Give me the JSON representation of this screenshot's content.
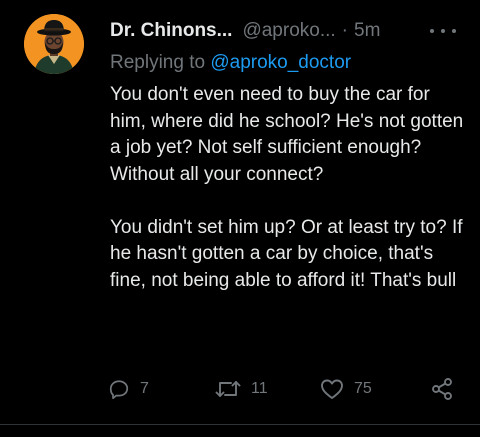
{
  "tweet": {
    "display_name": "Dr. Chinons...",
    "handle": "@aproko...",
    "separator": "·",
    "time": "5m",
    "reply_label": "Replying to",
    "reply_to": "@aproko_doctor",
    "paragraph_1": "You don't even need to buy the car for him, where did he school? He's not gotten a job yet? Not self sufficient enough? Without all your connect?",
    "paragraph_2": "You didn't set him up? Or at least try to? If he hasn't gotten a car by choice, that's fine, not being able to afford it! That's bull"
  },
  "actions": {
    "reply_count": "7",
    "retweet_count": "11",
    "like_count": "75"
  },
  "icons": {
    "avatar": "profile-photo",
    "more": "more-horizontal-icon",
    "reply": "reply-icon",
    "retweet": "retweet-icon",
    "like": "heart-icon",
    "share": "share-icon"
  },
  "colors": {
    "background": "#000000",
    "text": "#e7e9ea",
    "muted": "#71767b",
    "link": "#1d9bf0",
    "avatar_bg": "#f39422",
    "divider": "#2f3336"
  }
}
